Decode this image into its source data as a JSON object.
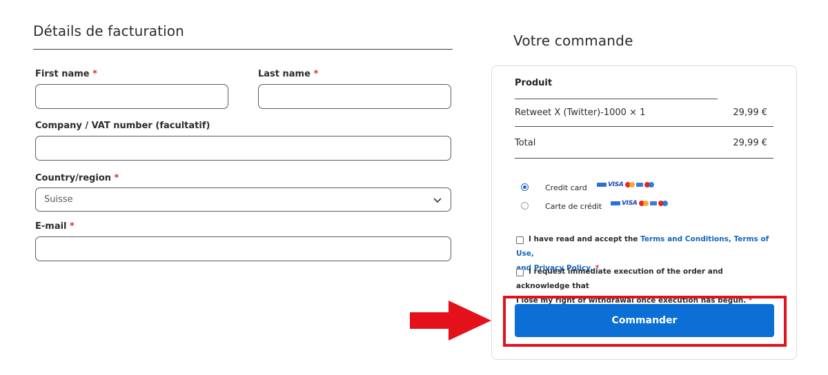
{
  "billing": {
    "title": "Détails de facturation",
    "fields": {
      "first_name": {
        "label": "First name",
        "required": "*",
        "value": ""
      },
      "last_name": {
        "label": "Last name",
        "required": "*",
        "value": ""
      },
      "company": {
        "label": "Company / VAT number",
        "optional": "(facultatif)",
        "value": ""
      },
      "country": {
        "label": "Country/region",
        "required": "*",
        "value": "Suisse"
      },
      "email": {
        "label": "E-mail",
        "required": "*",
        "value": ""
      }
    }
  },
  "order": {
    "title": "Votre commande",
    "table": {
      "header_product": "Produit",
      "item_name": "Retweet X (Twitter)-1000",
      "item_qty": "× 1",
      "item_price": "29,99 €",
      "total_label": "Total",
      "total_price": "29,99 €"
    },
    "payment": {
      "options": [
        {
          "label": "Credit card",
          "selected": true
        },
        {
          "label": "Carte de crédit",
          "selected": false
        }
      ],
      "card_brand": "VISA"
    },
    "terms": {
      "accept_prefix": "I have read and accept the",
      "accept_link": "Terms and Conditions, Terms of Use,",
      "accept_link2": "and Privacy Policy.",
      "accept_req": "*",
      "withdrawal_line1": "I request immediate execution of the order and acknowledge that",
      "withdrawal_line2": "I lose my right of withdrawal once execution has begun.",
      "withdrawal_req": "*"
    },
    "submit_label": "Commander"
  },
  "colors": {
    "accent": "#0b6fd6",
    "required": "#d32f2f",
    "highlight": "#e4101a",
    "link": "#1565c0"
  }
}
